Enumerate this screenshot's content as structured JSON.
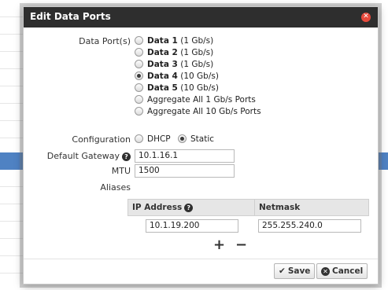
{
  "dialog": {
    "title": "Edit Data Ports",
    "close_icon": "close-icon"
  },
  "data_ports": {
    "label": "Data Port(s)",
    "options": [
      {
        "name": "Data 1",
        "speed": "(1 Gb/s)",
        "checked": false
      },
      {
        "name": "Data 2",
        "speed": "(1 Gb/s)",
        "checked": false
      },
      {
        "name": "Data 3",
        "speed": "(1 Gb/s)",
        "checked": false
      },
      {
        "name": "Data 4",
        "speed": "(10 Gb/s)",
        "checked": true
      },
      {
        "name": "Data 5",
        "speed": "(10 Gb/s)",
        "checked": false
      },
      {
        "name": "Aggregate All 1 Gb/s Ports",
        "speed": "",
        "checked": false
      },
      {
        "name": "Aggregate All 10 Gb/s Ports",
        "speed": "",
        "checked": false
      }
    ]
  },
  "configuration": {
    "label": "Configuration",
    "dhcp": "DHCP",
    "static": "Static",
    "selected": "Static"
  },
  "gateway": {
    "label": "Default Gateway",
    "help_icon": "question-icon",
    "value": "10.1.16.1"
  },
  "mtu": {
    "label": "MTU",
    "value": "1500"
  },
  "aliases": {
    "label": "Aliases",
    "columns": [
      "IP Address",
      "Netmask"
    ],
    "rows": [
      {
        "ip": "10.1.19.200",
        "netmask": "255.255.240.0"
      }
    ],
    "add": "+",
    "remove": "−"
  },
  "footer": {
    "save": "Save",
    "cancel": "Cancel"
  },
  "colors": {
    "header_bg": "#2e2e2e",
    "close": "#e84a3c",
    "selected_row": "#4f82c3"
  }
}
